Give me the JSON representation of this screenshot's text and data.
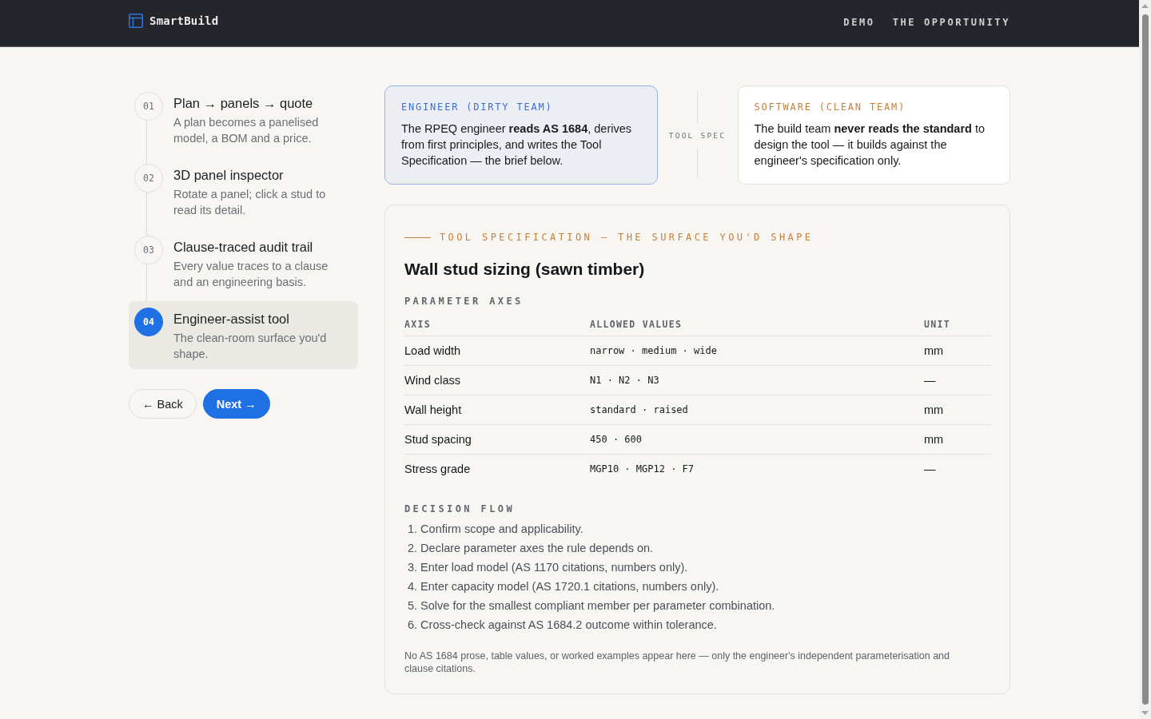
{
  "header": {
    "brand": "SmartBuild",
    "nav": [
      {
        "label": "DEMO"
      },
      {
        "label": "THE OPPORTUNITY"
      }
    ]
  },
  "steps": [
    {
      "number": "01",
      "title": "Plan → panels → quote",
      "description": "A plan becomes a panelised model, a BOM and a price.",
      "selected": false
    },
    {
      "number": "02",
      "title": "3D panel inspector",
      "description": "Rotate a panel; click a stud to read its detail.",
      "selected": false
    },
    {
      "number": "03",
      "title": "Clause-traced audit trail",
      "description": "Every value traces to a clause and an engineering basis.",
      "selected": false
    },
    {
      "number": "04",
      "title": "Engineer-assist tool",
      "description": "The clean-room surface you'd shape.",
      "selected": true
    }
  ],
  "buttons": [
    {
      "kind": "secondary",
      "label": "← Back"
    },
    {
      "kind": "primary",
      "label": "Next →"
    }
  ],
  "teams": [
    {
      "kind": "engineer",
      "label": "ENGINEER (DIRTY TEAM)",
      "text": "The RPEQ engineer **reads AS 1684**, derives from first principles, and writes the Tool Specification — the brief below."
    },
    {
      "kind": "software",
      "label": "SOFTWARE (CLEAN TEAM)",
      "text": "The build team **never reads the standard** to design the tool — it builds against the engineer's specification only."
    }
  ],
  "connector_label": "TOOL SPEC",
  "spec": {
    "eyebrow": "TOOL SPECIFICATION — THE SURFACE YOU'D SHAPE",
    "title": "Wall stud sizing (sawn timber)",
    "axes_heading": "PARAMETER AXES",
    "table": {
      "columns": [
        "AXIS",
        "ALLOWED VALUES",
        "UNIT"
      ],
      "rows": [
        [
          "Load width",
          "narrow · medium · wide",
          "mm"
        ],
        [
          "Wind class",
          "N1 · N2 · N3",
          "—"
        ],
        [
          "Wall height",
          "standard · raised",
          "mm"
        ],
        [
          "Stud spacing",
          "450 · 600",
          "mm"
        ],
        [
          "Stress grade",
          "MGP10 · MGP12 · F7",
          "—"
        ]
      ]
    },
    "flow_heading": "DECISION FLOW",
    "flow": [
      "1. Confirm scope and applicability.",
      "2. Declare parameter axes the rule depends on.",
      "3. Enter load model (AS 1170 citations, numbers only).",
      "4. Enter capacity model (AS 1720.1 citations, numbers only).",
      "5. Solve for the smallest compliant member per parameter combination.",
      "6. Cross-check against AS 1684.2 outcome within tolerance."
    ],
    "note": "No AS 1684 prose, table values, or worked examples appear here — only the engineer's independent parameterisation and clause citations."
  }
}
